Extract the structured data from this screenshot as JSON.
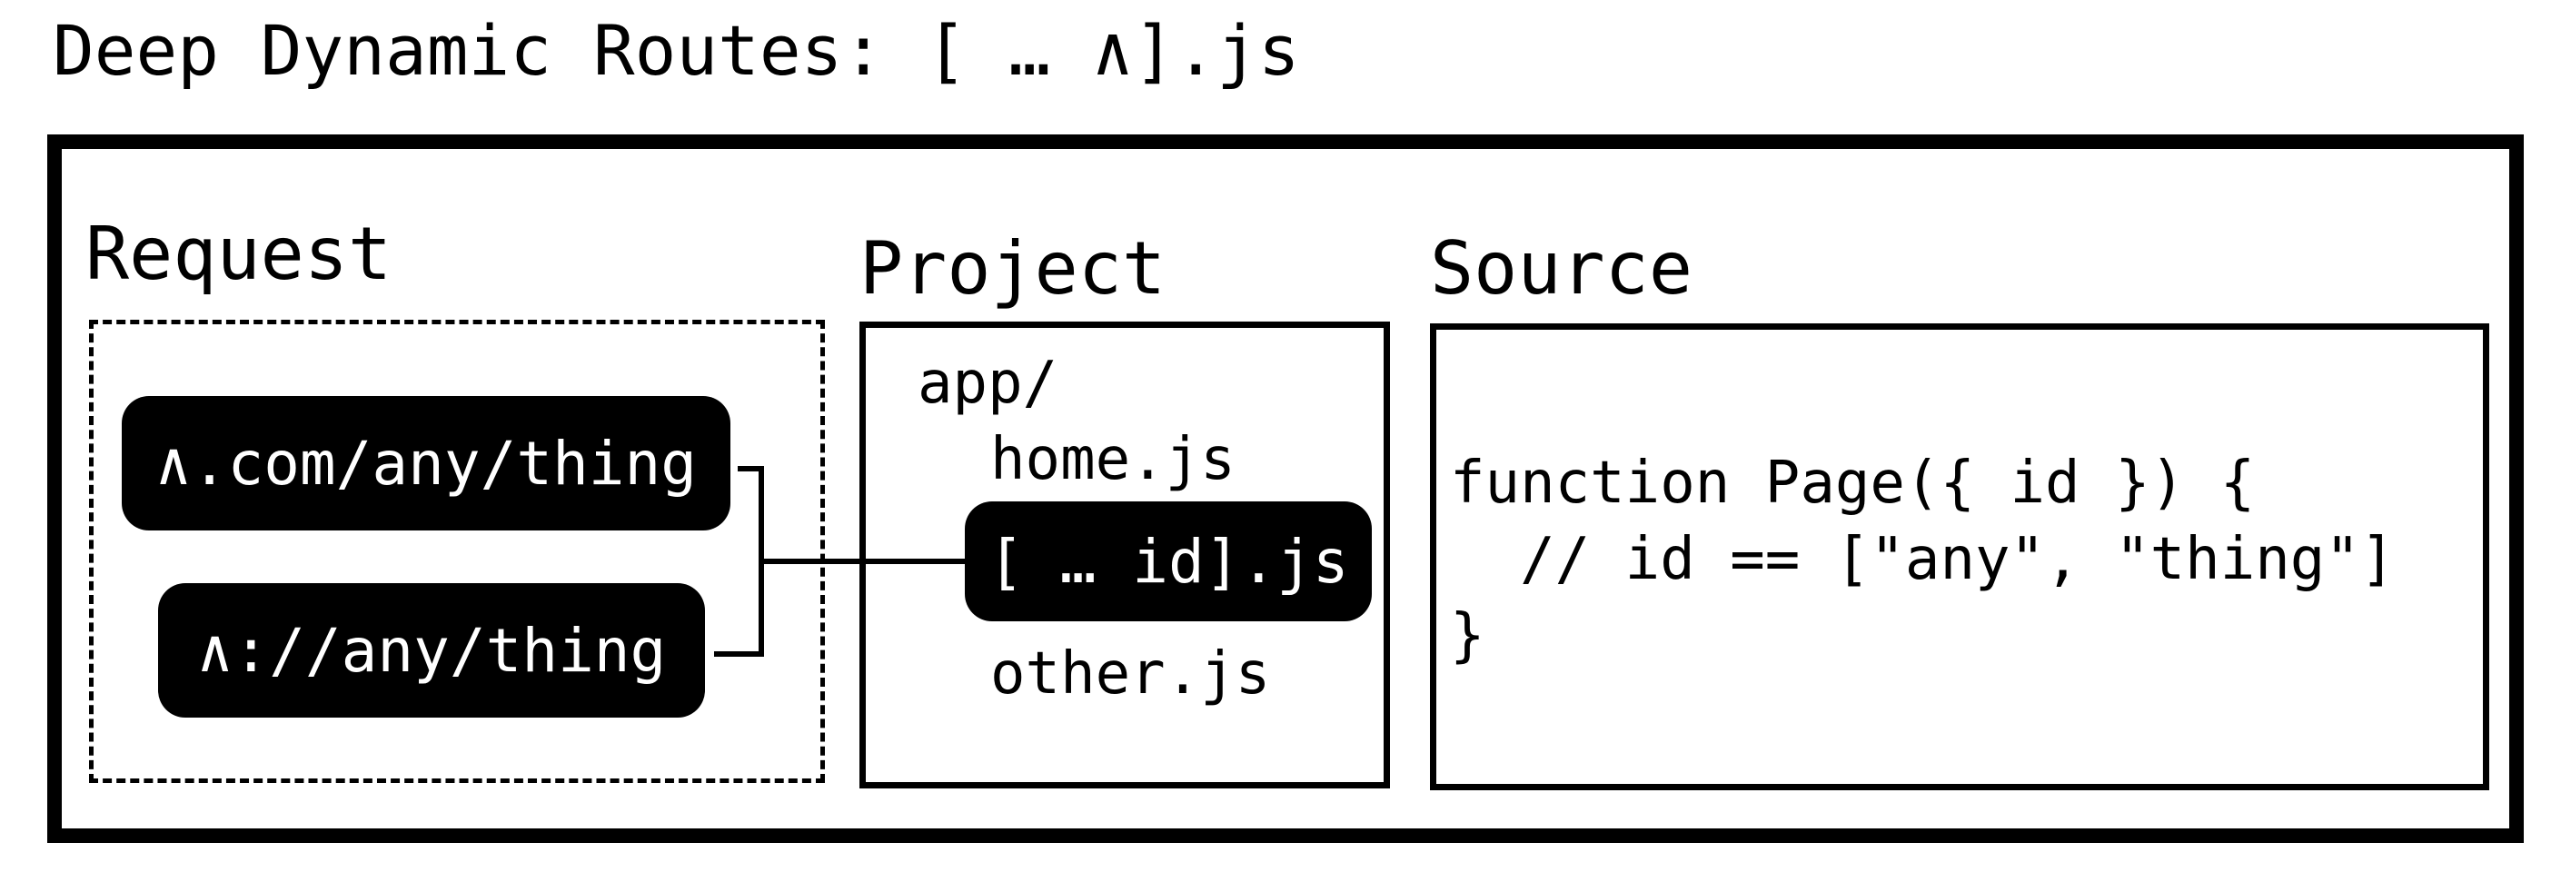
{
  "title": "Deep Dynamic Routes: [ … ∧].js",
  "request": {
    "heading": "Request",
    "urls": [
      "∧.com/any/thing",
      "∧://any/thing"
    ]
  },
  "project": {
    "heading": "Project",
    "folder": "app/",
    "files": [
      "home.js",
      "[ … id].js",
      "other.js"
    ],
    "highlighted_file": "[ … id].js"
  },
  "source": {
    "heading": "Source",
    "lines": [
      "function Page({ id }) {",
      "  // id == [\"any\", \"thing\"]",
      "}"
    ]
  },
  "colors": {
    "ink": "#000000",
    "background": "#ffffff",
    "pill_text": "#ffffff"
  }
}
